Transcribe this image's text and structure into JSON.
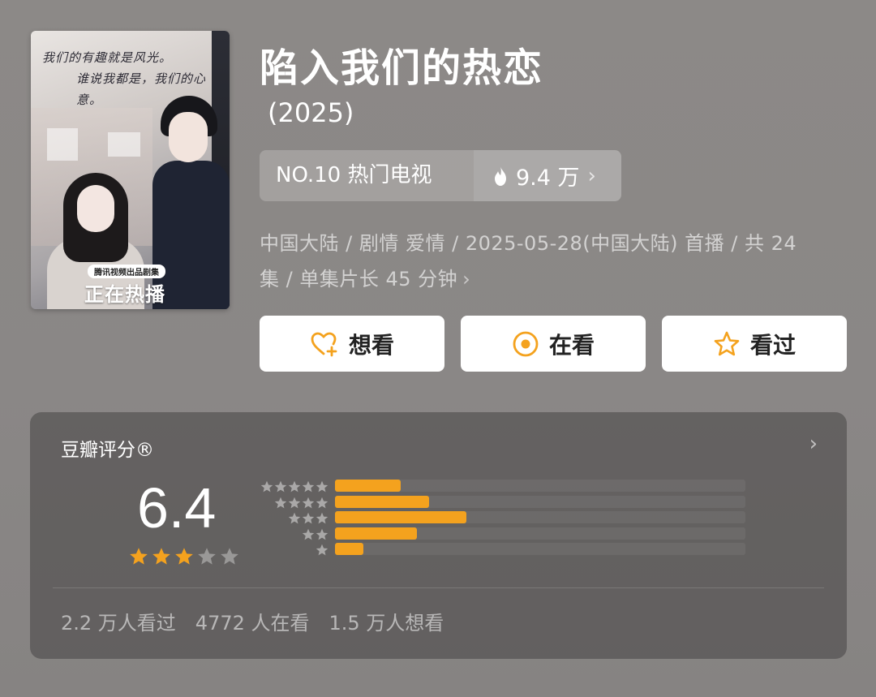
{
  "poster": {
    "handwriting_line1": "我们的有趣就是风光。",
    "handwriting_line2": "谁说我都是，我们的心意。",
    "badge": "腾讯视频出品剧集",
    "status": "正在热播"
  },
  "title": "陷入我们的热恋",
  "year": "(2025)",
  "rank": {
    "label": "NO.10 热门电视",
    "heat": "9.4 万",
    "icon": "flame-icon"
  },
  "meta": {
    "line1": "中国大陆 / 剧情 爱情 / 2025-05-28(中国大陆) 首播 / 共 24",
    "line2": "集 / 单集片长 45 分钟"
  },
  "actions": {
    "want": "想看",
    "watching": "在看",
    "watched": "看过"
  },
  "rating": {
    "title": "豆瓣评分®",
    "score": "6.4",
    "stars_filled": 3,
    "stars_total": 5,
    "distribution": [
      {
        "stars": 5,
        "fraction": 0.16
      },
      {
        "stars": 4,
        "fraction": 0.23
      },
      {
        "stars": 3,
        "fraction": 0.32
      },
      {
        "stars": 2,
        "fraction": 0.2
      },
      {
        "stars": 1,
        "fraction": 0.07
      }
    ],
    "stats": {
      "watched": "2.2 万人看过",
      "watching": "4772 人在看",
      "want": "1.5 万人想看"
    }
  },
  "colors": {
    "accent": "#f4a21e",
    "button_bg": "#ffffff"
  }
}
